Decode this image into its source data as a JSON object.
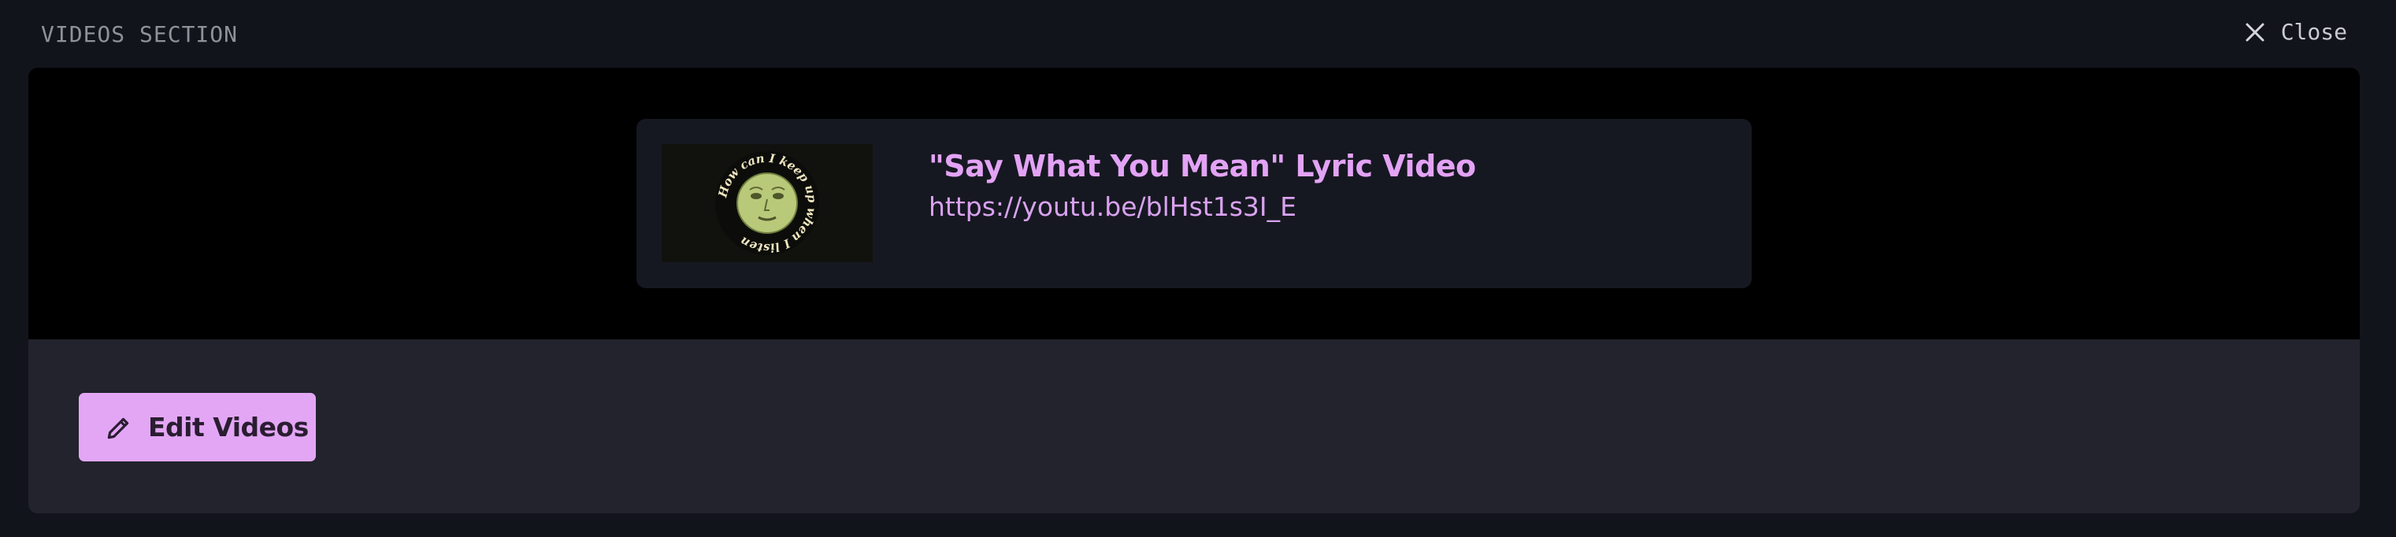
{
  "header": {
    "title": "VIDEOS SECTION",
    "close_label": "Close",
    "close_icon": "close-icon"
  },
  "videos": [
    {
      "title": "\"Say What You Mean\" Lyric Video",
      "url": "https://youtu.be/blHst1s3I_E",
      "thumbnail": {
        "icon": "moon-face-thumbnail",
        "caption": "How can I keep up when I listen"
      }
    }
  ],
  "actions": {
    "edit_label": "Edit Videos",
    "edit_icon": "pencil-icon"
  },
  "colors": {
    "page_background": "#12141c",
    "panel_background": "#22232d",
    "preview_background": "#000000",
    "card_background": "#161821",
    "accent": "#e3a6f5",
    "title_text": "#e3a3f5"
  }
}
